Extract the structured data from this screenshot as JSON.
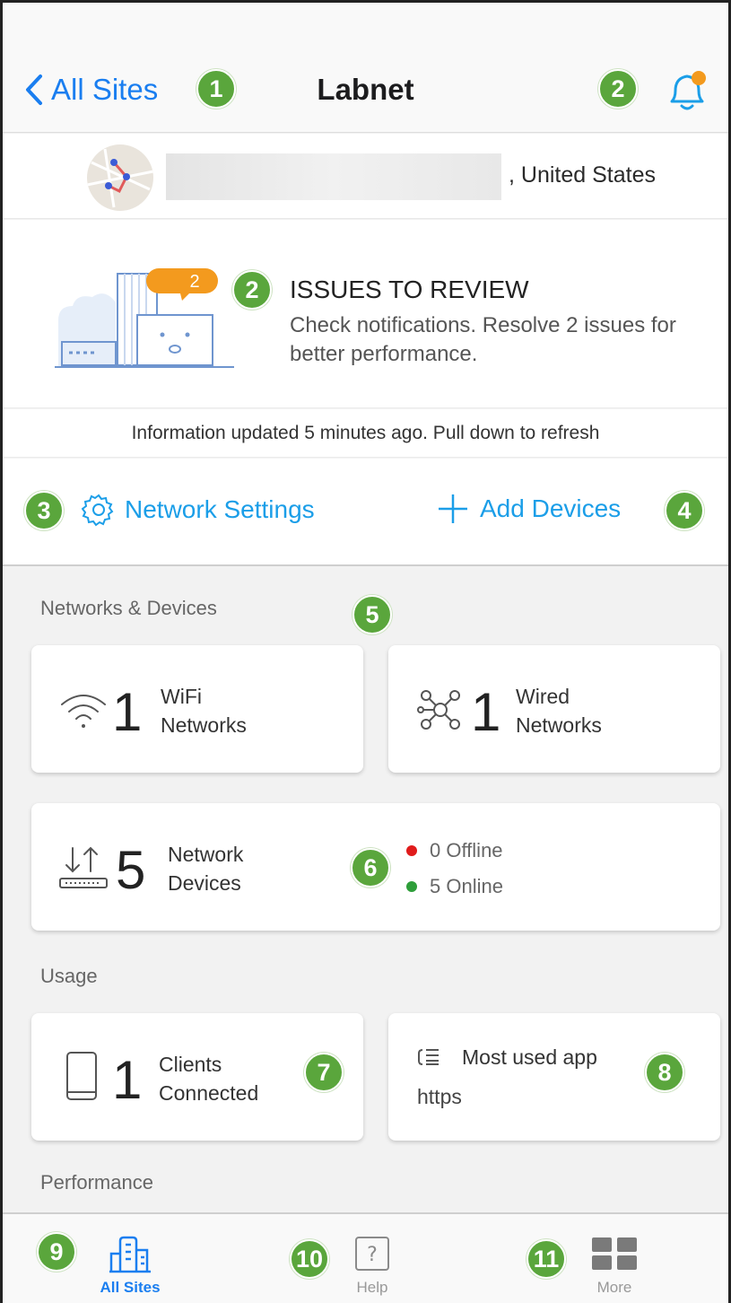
{
  "header": {
    "back_label": "All Sites",
    "title": "Labnet"
  },
  "location": {
    "country": ", United States"
  },
  "issues": {
    "count_bubble": "2",
    "title": "ISSUES TO REVIEW",
    "description": "Check notifications. Resolve 2 issues for better performance."
  },
  "status": {
    "updated_text": "Information updated 5 minutes ago. Pull down to refresh"
  },
  "actions": {
    "network_settings": "Network Settings",
    "add_devices": "Add Devices"
  },
  "networks": {
    "section_label": "Networks & Devices",
    "wifi": {
      "count": "1",
      "label_line1": "WiFi",
      "label_line2": "Networks"
    },
    "wired": {
      "count": "1",
      "label_line1": "Wired",
      "label_line2": "Networks"
    },
    "devices": {
      "count": "5",
      "label_line1": "Network",
      "label_line2": "Devices",
      "offline": "0 Offline",
      "online": "5 Online"
    }
  },
  "usage": {
    "section_label": "Usage",
    "clients": {
      "count": "1",
      "label_line1": "Clients",
      "label_line2": "Connected"
    },
    "most_used": {
      "label": "Most used app",
      "value": "https"
    }
  },
  "performance": {
    "section_label": "Performance"
  },
  "tabs": [
    {
      "label": "All Sites"
    },
    {
      "label": "Help"
    },
    {
      "label": "More"
    }
  ],
  "callouts": [
    "1",
    "2",
    "2",
    "3",
    "4",
    "5",
    "6",
    "7",
    "8",
    "9",
    "10",
    "11"
  ],
  "colors": {
    "accent_blue": "#1a7ef0",
    "link_blue": "#1b9ee8",
    "callout_green": "#5aa63c",
    "notification_orange": "#f39a1e",
    "offline_red": "#e01b1b",
    "online_green": "#2e9e3a"
  },
  "icons": {
    "back": "chevron-left-icon",
    "bell": "bell-icon",
    "settings": "gear-icon",
    "add": "plus-icon",
    "wifi": "wifi-icon",
    "wired": "network-topology-icon",
    "devices": "switch-icon",
    "clients": "tablet-icon",
    "app": "app-list-icon",
    "sites": "buildings-icon",
    "help": "question-icon",
    "more": "grid-icon"
  }
}
